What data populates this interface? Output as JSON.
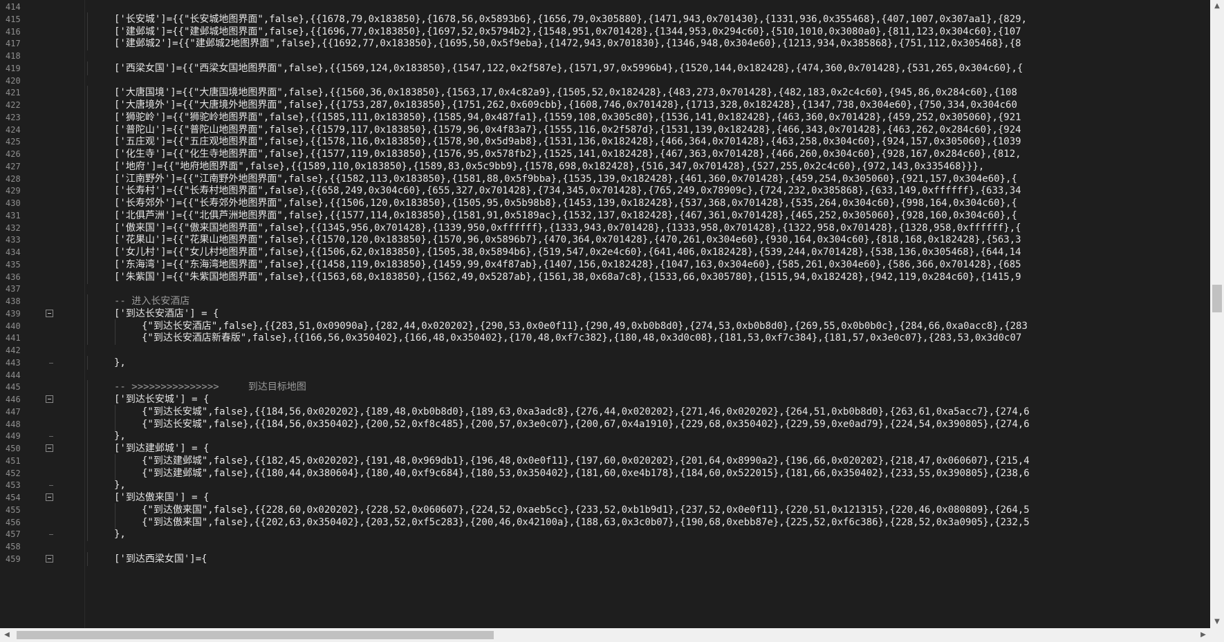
{
  "editor": {
    "lines": [
      {
        "n": "414",
        "ind": 0,
        "text": "",
        "kind": "blank",
        "fold": "none"
      },
      {
        "n": "415",
        "ind": 1,
        "text": "['长安城']={{\"长安城地图界面\",false},{{1678,79,0x183850},{1678,56,0x5893b6},{1656,79,0x305880},{1471,943,0x701430},{1331,936,0x355468},{407,1007,0x307aa1},{829,",
        "kind": "code",
        "fold": "none"
      },
      {
        "n": "416",
        "ind": 1,
        "text": "['建邺城']={{\"建邺城地图界面\",false},{{1696,77,0x183850},{1697,52,0x5794b2},{1548,951,0x701428},{1344,953,0x294c60},{510,1010,0x3080a0},{811,123,0x304c60},{107",
        "kind": "code",
        "fold": "none"
      },
      {
        "n": "417",
        "ind": 1,
        "text": "['建邺城2']={{\"建邺城2地图界面\",false},{{1692,77,0x183850},{1695,50,0x5f9eba},{1472,943,0x701830},{1346,948,0x304e60},{1213,934,0x385868},{751,112,0x305468},{8",
        "kind": "code",
        "fold": "none"
      },
      {
        "n": "418",
        "ind": 0,
        "text": "",
        "kind": "blank",
        "fold": "none"
      },
      {
        "n": "419",
        "ind": 1,
        "text": "['西梁女国']={{\"西梁女国地图界面\",false},{{1569,124,0x183850},{1547,122,0x2f587e},{1571,97,0x5996b4},{1520,144,0x182428},{474,360,0x701428},{531,265,0x304c60},{",
        "kind": "code",
        "fold": "none"
      },
      {
        "n": "420",
        "ind": 0,
        "text": "",
        "kind": "blank",
        "fold": "none"
      },
      {
        "n": "421",
        "ind": 1,
        "text": "['大唐国境']={{\"大唐国境地图界面\",false},{{1560,36,0x183850},{1563,17,0x4c82a9},{1505,52,0x182428},{483,273,0x701428},{482,183,0x2c4c60},{945,86,0x284c60},{108",
        "kind": "code",
        "fold": "none"
      },
      {
        "n": "422",
        "ind": 1,
        "text": "['大唐境外']={{\"大唐境外地图界面\",false},{{1753,287,0x183850},{1751,262,0x609cbb},{1608,746,0x701428},{1713,328,0x182428},{1347,738,0x304e60},{750,334,0x304c60",
        "kind": "code",
        "fold": "none"
      },
      {
        "n": "423",
        "ind": 1,
        "text": "['狮驼岭']={{\"狮驼岭地图界面\",false},{{1585,111,0x183850},{1585,94,0x487fa1},{1559,108,0x305c80},{1536,141,0x182428},{463,360,0x701428},{459,252,0x305060},{921",
        "kind": "code",
        "fold": "none"
      },
      {
        "n": "424",
        "ind": 1,
        "text": "['普陀山']={{\"普陀山地图界面\",false},{{1579,117,0x183850},{1579,96,0x4f83a7},{1555,116,0x2f587d},{1531,139,0x182428},{466,343,0x701428},{463,262,0x284c60},{924",
        "kind": "code",
        "fold": "none"
      },
      {
        "n": "425",
        "ind": 1,
        "text": "['五庄观']={{\"五庄观地图界面\",false},{{1578,116,0x183850},{1578,90,0x5d9ab8},{1531,136,0x182428},{466,364,0x701428},{463,258,0x304c60},{924,157,0x305060},{1039",
        "kind": "code",
        "fold": "none"
      },
      {
        "n": "426",
        "ind": 1,
        "text": "['化生寺']={{\"化生寺地图界面\",false},{{1577,119,0x183850},{1576,95,0x578fb2},{1525,141,0x182428},{467,363,0x701428},{466,260,0x304c60},{928,167,0x284c60},{812,",
        "kind": "code",
        "fold": "none"
      },
      {
        "n": "427",
        "ind": 1,
        "text": "['地府']={{\"地府地图界面\",false},{{1589,110,0x183850},{1589,83,0x5c9bb9},{1578,698,0x182428},{516,347,0x701428},{527,255,0x2c4c60},{972,143,0x335468}}},",
        "kind": "code",
        "fold": "none"
      },
      {
        "n": "428",
        "ind": 1,
        "text": "['江南野外']={{\"江南野外地图界面\",false},{{1582,113,0x183850},{1581,88,0x5f9bba},{1535,139,0x182428},{461,360,0x701428},{459,254,0x305060},{921,157,0x304e60},{",
        "kind": "code",
        "fold": "none"
      },
      {
        "n": "429",
        "ind": 1,
        "text": "['长寿村']={{\"长寿村地图界面\",false},{{658,249,0x304c60},{655,327,0x701428},{734,345,0x701428},{765,249,0x78909c},{724,232,0x385868},{633,149,0xffffff},{633,34",
        "kind": "code",
        "fold": "none"
      },
      {
        "n": "430",
        "ind": 1,
        "text": "['长寿郊外']={{\"长寿郊外地图界面\",false},{{1506,120,0x183850},{1505,95,0x5b98b8},{1453,139,0x182428},{537,368,0x701428},{535,264,0x304c60},{998,164,0x304c60},{",
        "kind": "code",
        "fold": "none"
      },
      {
        "n": "431",
        "ind": 1,
        "text": "['北俱芦洲']={{\"北俱芦洲地图界面\",false},{{1577,114,0x183850},{1581,91,0x5189ac},{1532,137,0x182428},{467,361,0x701428},{465,252,0x305060},{928,160,0x304c60},{",
        "kind": "code",
        "fold": "none"
      },
      {
        "n": "432",
        "ind": 1,
        "text": "['傲来国']={{\"傲来国地图界面\",false},{{1345,956,0x701428},{1339,950,0xffffff},{1333,943,0x701428},{1333,958,0x701428},{1322,958,0x701428},{1328,958,0xffffff},{",
        "kind": "code",
        "fold": "none"
      },
      {
        "n": "433",
        "ind": 1,
        "text": "['花果山']={{\"花果山地图界面\",false},{{1570,120,0x183850},{1570,96,0x5896b7},{470,364,0x701428},{470,261,0x304e60},{930,164,0x304c60},{818,168,0x182428},{563,3",
        "kind": "code",
        "fold": "none"
      },
      {
        "n": "434",
        "ind": 1,
        "text": "['女儿村']={{\"女儿村地图界面\",false},{{1506,62,0x183850},{1505,38,0x5894b6},{519,547,0x2e4c60},{641,406,0x182428},{539,244,0x701428},{538,136,0x305468},{644,14",
        "kind": "code",
        "fold": "none"
      },
      {
        "n": "435",
        "ind": 1,
        "text": "['东海湾']={{\"东海湾地图界面\",false},{{1458,119,0x183850},{1459,99,0x4f87ab},{1407,156,0x182428},{1047,163,0x304e60},{585,261,0x304e60},{586,366,0x701428},{685",
        "kind": "code",
        "fold": "none"
      },
      {
        "n": "436",
        "ind": 1,
        "text": "['朱紫国']={{\"朱紫国地图界面\",false},{{1563,68,0x183850},{1562,49,0x5287ab},{1561,38,0x68a7c8},{1533,66,0x305780},{1515,94,0x182428},{942,119,0x284c60},{1415,9",
        "kind": "code",
        "fold": "none"
      },
      {
        "n": "437",
        "ind": 0,
        "text": "",
        "kind": "blank",
        "fold": "none"
      },
      {
        "n": "438",
        "ind": 1,
        "text": "-- 进入长安酒店",
        "kind": "comment",
        "fold": "none"
      },
      {
        "n": "439",
        "ind": 1,
        "text": "['到达长安酒店'] = {",
        "kind": "code",
        "fold": "open"
      },
      {
        "n": "440",
        "ind": 2,
        "text": "{\"到达长安酒店\",false},{{283,51,0x09090a},{282,44,0x020202},{290,53,0x0e0f11},{290,49,0xb0b8d0},{274,53,0xb0b8d0},{269,55,0x0b0b0c},{284,66,0xa0acc8},{283",
        "kind": "code",
        "fold": "none"
      },
      {
        "n": "441",
        "ind": 2,
        "text": "{\"到达长安酒店新春版\",false},{{166,56,0x350402},{166,48,0x350402},{170,48,0xf7c382},{180,48,0x3d0c08},{181,53,0xf7c384},{181,57,0x3e0c07},{283,53,0x3d0c07",
        "kind": "code",
        "fold": "none"
      },
      {
        "n": "442",
        "ind": 0,
        "text": "",
        "kind": "blank",
        "fold": "none"
      },
      {
        "n": "443",
        "ind": 1,
        "text": "},",
        "kind": "code",
        "fold": "end"
      },
      {
        "n": "444",
        "ind": 0,
        "text": "",
        "kind": "blank",
        "fold": "none"
      },
      {
        "n": "445",
        "ind": 1,
        "text": "-- >>>>>>>>>>>>>>>     到达目标地图",
        "kind": "comment",
        "fold": "none"
      },
      {
        "n": "446",
        "ind": 1,
        "text": "['到达长安城'] = {",
        "kind": "code",
        "fold": "open"
      },
      {
        "n": "447",
        "ind": 2,
        "text": "{\"到达长安城\",false},{{184,56,0x020202},{189,48,0xb0b8d0},{189,63,0xa3adc8},{276,44,0x020202},{271,46,0x020202},{264,51,0xb0b8d0},{263,61,0xa5acc7},{274,6",
        "kind": "code",
        "fold": "none"
      },
      {
        "n": "448",
        "ind": 2,
        "text": "{\"到达长安城\",false},{{184,56,0x350402},{200,52,0xf8c485},{200,57,0x3e0c07},{200,67,0x4a1910},{229,68,0x350402},{229,59,0xe0ad79},{224,54,0x390805},{274,6",
        "kind": "code",
        "fold": "none"
      },
      {
        "n": "449",
        "ind": 1,
        "text": "},",
        "kind": "code",
        "fold": "end"
      },
      {
        "n": "450",
        "ind": 1,
        "text": "['到达建邺城'] = {",
        "kind": "code",
        "fold": "open"
      },
      {
        "n": "451",
        "ind": 2,
        "text": "{\"到达建邺城\",false},{{182,45,0x020202},{191,48,0x969db1},{196,48,0x0e0f11},{197,60,0x020202},{201,64,0x8990a2},{196,66,0x020202},{218,47,0x060607},{215,4",
        "kind": "code",
        "fold": "none"
      },
      {
        "n": "452",
        "ind": 2,
        "text": "{\"到达建邺城\",false},{{180,44,0x380604},{180,40,0xf9c684},{180,53,0x350402},{181,60,0xe4b178},{184,60,0x522015},{181,66,0x350402},{233,55,0x390805},{238,6",
        "kind": "code",
        "fold": "none"
      },
      {
        "n": "453",
        "ind": 1,
        "text": "},",
        "kind": "code",
        "fold": "end"
      },
      {
        "n": "454",
        "ind": 1,
        "text": "['到达傲来国'] = {",
        "kind": "code",
        "fold": "open"
      },
      {
        "n": "455",
        "ind": 2,
        "text": "{\"到达傲来国\",false},{{228,60,0x020202},{228,52,0x060607},{224,52,0xaeb5cc},{233,52,0xb1b9d1},{237,52,0x0e0f11},{220,51,0x121315},{220,46,0x080809},{264,5",
        "kind": "code",
        "fold": "none"
      },
      {
        "n": "456",
        "ind": 2,
        "text": "{\"到达傲来国\",false},{{202,63,0x350402},{203,52,0xf5c283},{200,46,0x42100a},{188,63,0x3c0b07},{190,68,0xebb87e},{225,52,0xf6c386},{228,52,0x3a0905},{232,5",
        "kind": "code",
        "fold": "none"
      },
      {
        "n": "457",
        "ind": 1,
        "text": "},",
        "kind": "code",
        "fold": "end"
      },
      {
        "n": "458",
        "ind": 0,
        "text": "",
        "kind": "blank",
        "fold": "none"
      },
      {
        "n": "459",
        "ind": 1,
        "text": "['到达西梁女国']={",
        "kind": "code",
        "fold": "open"
      }
    ]
  },
  "scrollbars": {
    "vertical": {
      "up_icon": "▲",
      "down_icon": "▼"
    },
    "horizontal": {
      "left_icon": "◀",
      "right_icon": "▶"
    }
  },
  "colors": {
    "background": "#1e1e1e",
    "text": "#e6e6e6",
    "line_number": "#8f8f8f",
    "comment": "#9a9a9a"
  }
}
